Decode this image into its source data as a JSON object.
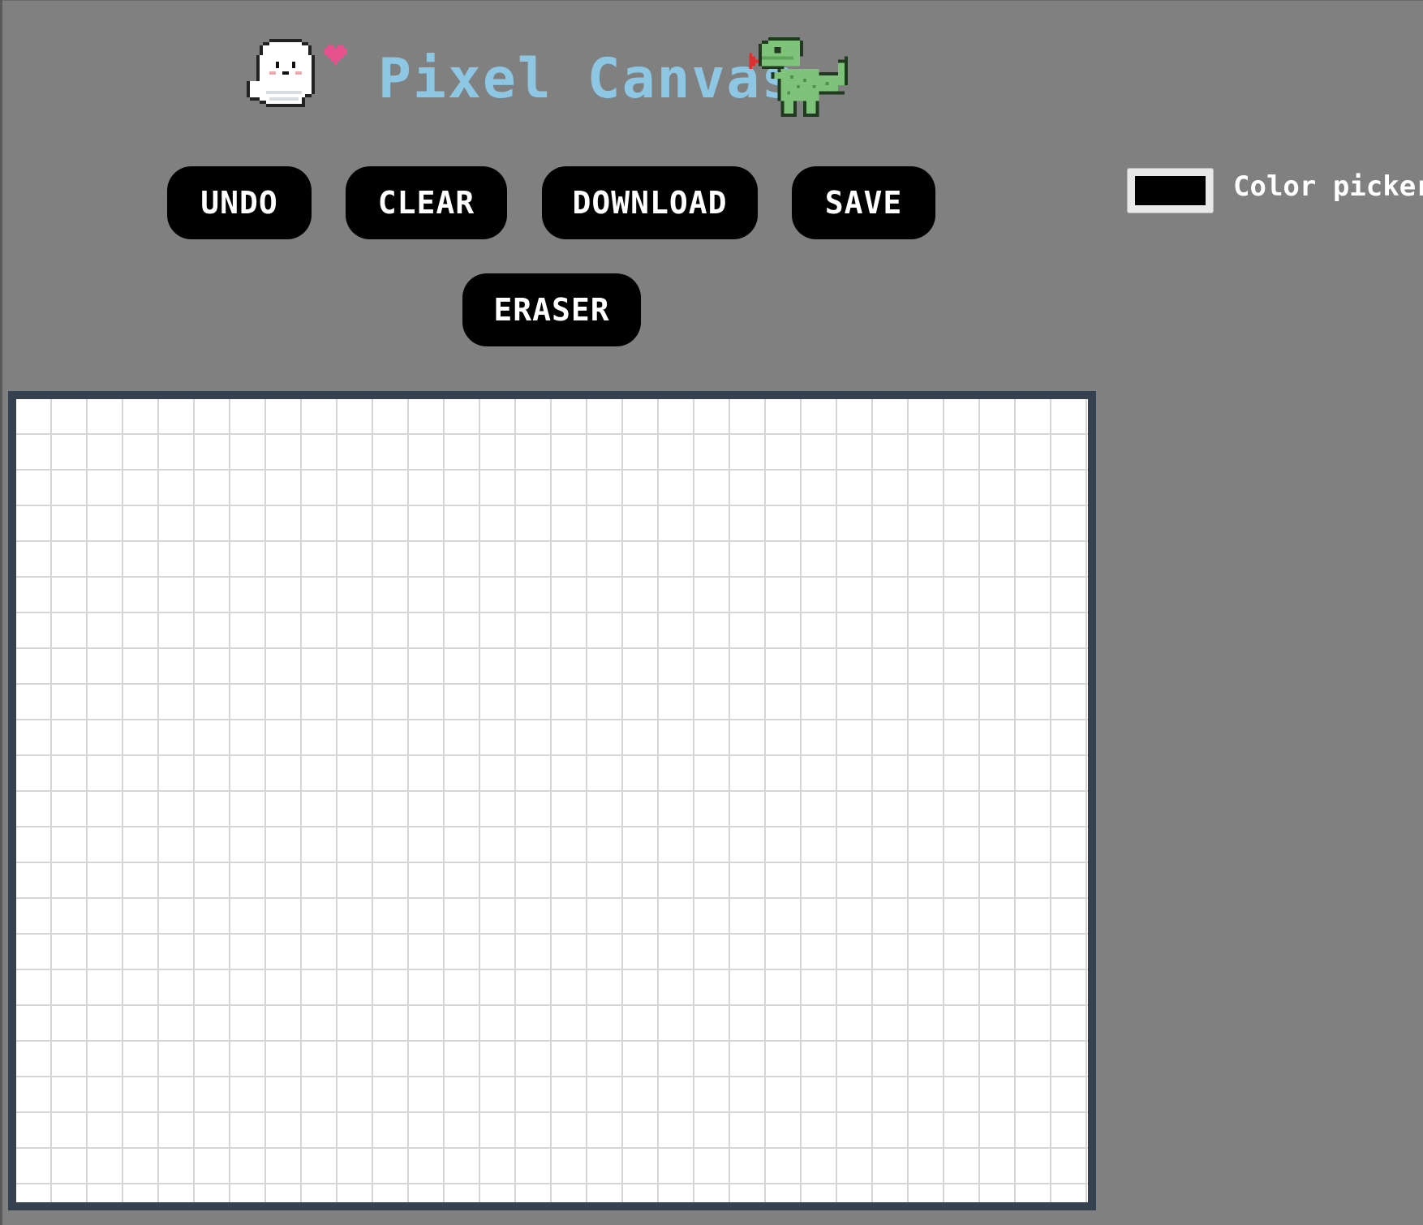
{
  "header": {
    "title": "Pixel Canvas",
    "left_sprite": "ghost-with-heart-icon",
    "right_sprite": "dinosaur-icon"
  },
  "toolbar": {
    "undo_label": "UNDO",
    "clear_label": "CLEAR",
    "download_label": "DOWNLOAD",
    "save_label": "SAVE",
    "eraser_label": "ERASER"
  },
  "color_picker": {
    "label": "Color picker",
    "value": "#000000"
  },
  "canvas": {
    "background": "#ffffff",
    "grid_line_color": "#d4d4d4",
    "frame_color": "#36414f"
  },
  "theme": {
    "page_background": "#808080",
    "title_color": "#8ec7e3",
    "button_background": "#000000",
    "button_text": "#ffffff"
  }
}
